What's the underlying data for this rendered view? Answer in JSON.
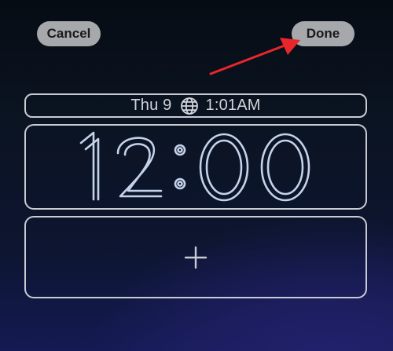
{
  "header": {
    "cancel_label": "Cancel",
    "done_label": "Done"
  },
  "date_widget": {
    "date_text": "Thu 9",
    "globe_icon": "globe-icon",
    "time_text": "1:01AM"
  },
  "clock": {
    "time": "12:00"
  },
  "widget_area": {
    "add_icon": "plus-icon"
  },
  "annotation": {
    "arrow_color": "#e8262c"
  }
}
